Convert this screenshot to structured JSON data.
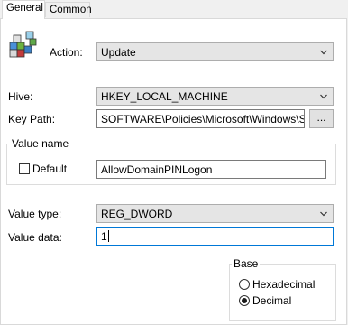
{
  "tabs": [
    {
      "label": "General",
      "active": true
    },
    {
      "label": "Common",
      "active": false
    }
  ],
  "icon": "registry-cubes-icon",
  "action": {
    "label": "Action:",
    "value": "Update"
  },
  "hive": {
    "label": "Hive:",
    "value": "HKEY_LOCAL_MACHINE"
  },
  "key_path": {
    "label": "Key Path:",
    "value": "SOFTWARE\\Policies\\Microsoft\\Windows\\System",
    "browse_label": "..."
  },
  "value_name": {
    "group_title": "Value name",
    "default_label": "Default",
    "default_checked": false,
    "value": "AllowDomainPINLogon"
  },
  "value_type": {
    "label": "Value type:",
    "value": "REG_DWORD"
  },
  "value_data": {
    "label": "Value data:",
    "value": "1"
  },
  "base": {
    "group_title": "Base",
    "options": [
      {
        "label": "Hexadecimal",
        "selected": false
      },
      {
        "label": "Decimal",
        "selected": true
      }
    ]
  },
  "colors": {
    "accent": "#0078d7",
    "background": "#f0f0f0",
    "panel": "#ffffff"
  }
}
